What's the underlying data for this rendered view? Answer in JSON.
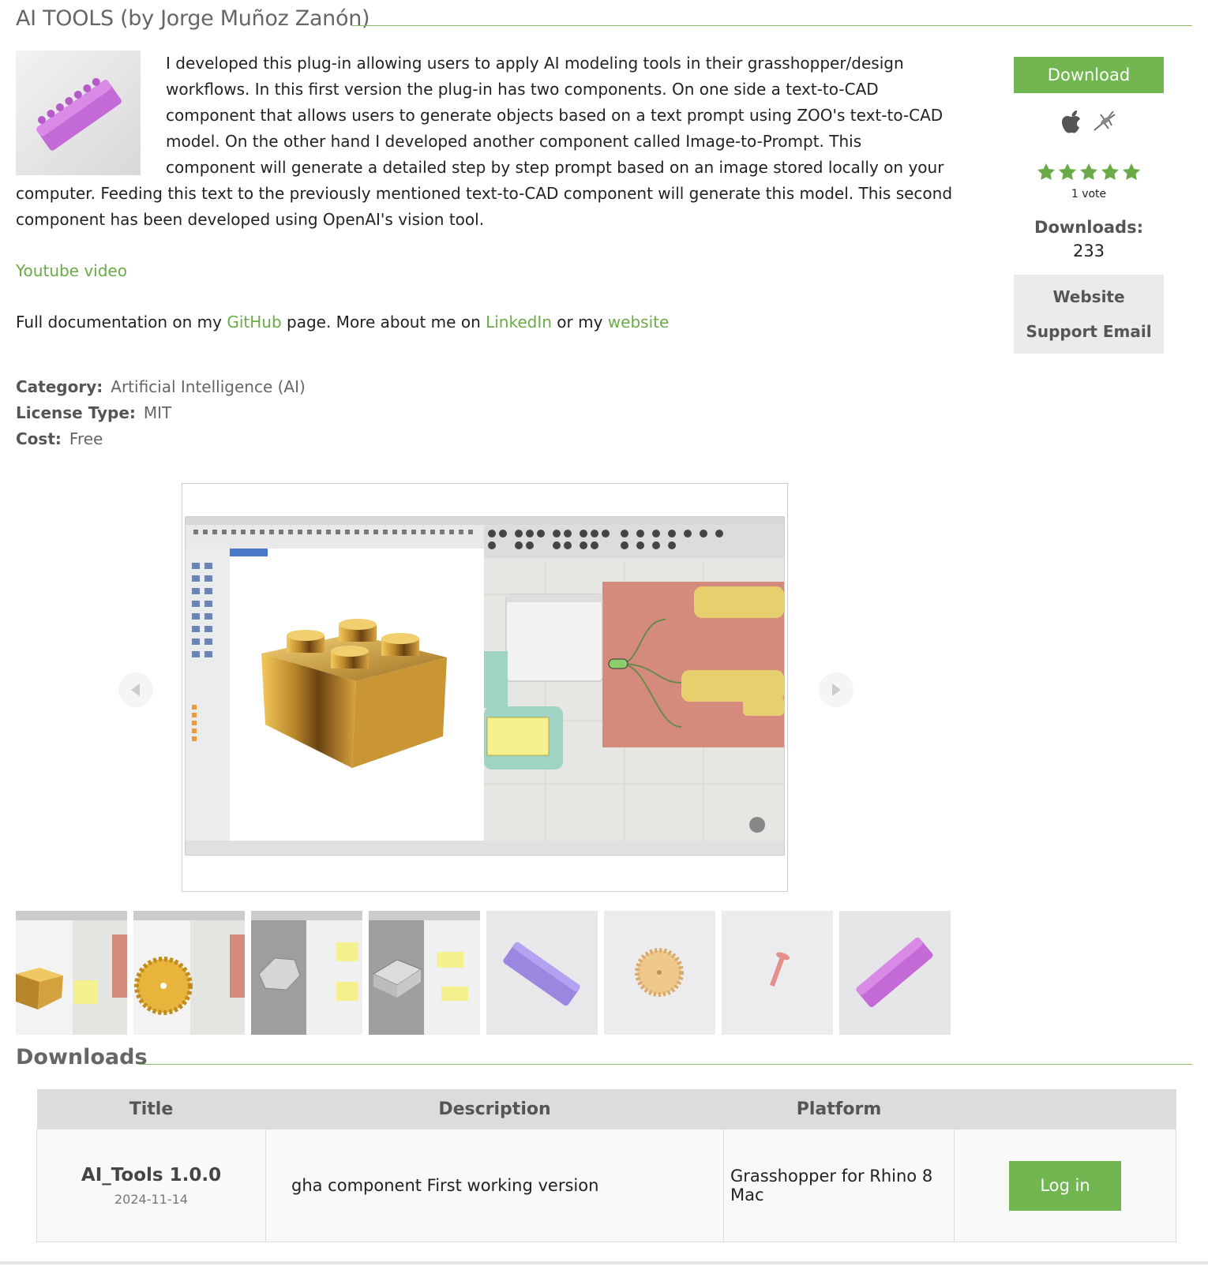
{
  "header": {
    "title": "AI TOOLS (by Jorge Muñoz Zanón)"
  },
  "description": {
    "paragraph1": "I developed this plug-in allowing users to apply AI modeling tools in their grasshopper/design workflows. In this first version the plug-in has two components. On one side a text-to-CAD component that allows users to generate objects based on a text prompt using ZOO's text-to-CAD model. On the other hand I developed another component called Image-to-Prompt. This component will generate a detailed step by step prompt based on an image stored locally on your computer. Feeding this text to the previously mentioned text-to-CAD component will generate this model. This second component has been developed using OpenAI's vision tool.",
    "youtube_link": "Youtube video",
    "doc_prefix": "Full documentation on my",
    "github_link": "GitHub",
    "doc_middle": "page. More about me on",
    "linkedin_link": "LinkedIn",
    "doc_or": "or my",
    "website_link": "website"
  },
  "sidebar": {
    "download_label": "Download",
    "votes": "1 vote",
    "rating_stars": 5,
    "downloads_label": "Downloads:",
    "downloads_count": "233",
    "website_label": "Website",
    "support_label": "Support Email"
  },
  "meta": {
    "category_label": "Category:",
    "category_value": "Artificial Intelligence (AI)",
    "license_label": "License Type:",
    "license_value": "MIT",
    "cost_label": "Cost:",
    "cost_value": "Free"
  },
  "downloads_section": {
    "title": "Downloads",
    "columns": [
      "Title",
      "Description",
      "Platform",
      ""
    ],
    "rows": [
      {
        "title": "AI_Tools 1.0.0",
        "date": "2024-11-14",
        "description": "gha component First working version",
        "platform": "Grasshopper for Rhino 8 Mac",
        "action": "Log in"
      }
    ]
  },
  "colors": {
    "accent": "#71b650",
    "link": "#6aab47",
    "header_gray": "#dcdcdc"
  }
}
